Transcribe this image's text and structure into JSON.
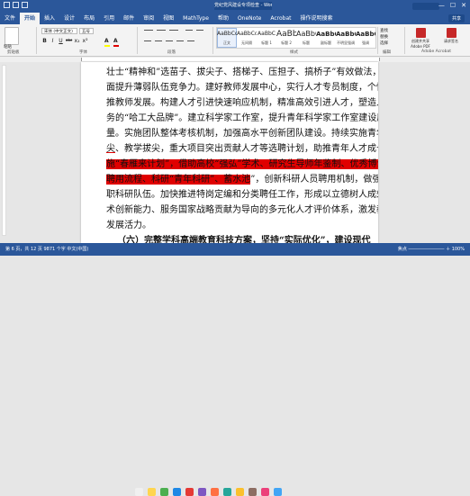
{
  "window": {
    "title": "党纪党风建设专项检查 - Word",
    "minimize": "—",
    "maximize": "☐",
    "close": "✕"
  },
  "tabs": [
    "文件",
    "开始",
    "插入",
    "设计",
    "布局",
    "引用",
    "邮件",
    "审阅",
    "视图",
    "MathType",
    "帮助",
    "OneNote",
    "Acrobat",
    "操作说明搜索"
  ],
  "share_label": "共享",
  "ribbon": {
    "paste_label": "粘贴",
    "font_name": "宋体 (中文正文)",
    "font_size": "五号",
    "format_buttons": [
      "B",
      "I",
      "U",
      "abc",
      "x₂",
      "x²"
    ],
    "highlight_glyph": "A",
    "font_color_glyph": "A",
    "styles": [
      {
        "sample": "AaBbCcDd",
        "name": "正文"
      },
      {
        "sample": "AaBbCcDd",
        "name": "无间隔"
      },
      {
        "sample": "AaBbC",
        "name": "标题 1"
      },
      {
        "sample": "AaBbC",
        "name": "标题 2"
      },
      {
        "sample": "AaBbC",
        "name": "标题"
      },
      {
        "sample": "AaBbC",
        "name": "副标题"
      },
      {
        "sample": "AaBbC",
        "name": "不明显强调"
      },
      {
        "sample": "AaBbCc",
        "name": "强调"
      }
    ],
    "edit_items": [
      "查找",
      "替换",
      "选择"
    ],
    "acrobat_buttons": [
      "创建并共享 Adobe PDF",
      "请求签名"
    ],
    "group_labels": [
      "剪贴板",
      "字体",
      "段落",
      "样式",
      "编辑",
      "Adobe Acrobat"
    ]
  },
  "document": {
    "line1": "壮士“精神和”选苗子、拔尖子、搭梯子、压担子、搞桥子”有效做法，全",
    "line2": "面提升薄弱队伍竞争力。建好教师发展中心，实行人才专员制度，个性化助",
    "line3": "推教师发展。构建人才引进快速响应机制，精准高效引进人才，塑造人才服",
    "line4": "务的“哈工大品牌”。建立科学家工作室，提升青年科学家工作室建设质",
    "line5": "量。实施团队整体考核机制，加强高水平创新团队建设。持续实施青年拔",
    "line6a": "尖",
    "line6b": "、教学拔尖，重大项目突出贡献人才等选聘计划，助推青年人才成长。",
    "line6c": "实",
    "line7": "施“春雁来计划”，借助高校“强弘”学术、研究生导师年鉴制、优秀博士后",
    "line8a": "聘用流程、科",
    "line8b": "研“青年科研”、蓄水池",
    "line8c": "”，创新科研人员聘用机制，做强专",
    "line9": "职科研队伍。加快推进特岗定编和分类聘任工作，形成以立德树人成效、学",
    "line10": "术创新能力、服务国家战略贡献为导向的多元化人才评价体系，激发教职工",
    "line11": "发展活力。",
    "heading": "（六）完整学科高端教育科技方案，坚持“实际优化”，建设现代"
  },
  "status": {
    "left": "第 6 页，共 12 页   9871 个字   中文(中国)",
    "right": "焦点   ―――――――― ＋ 100%"
  },
  "colors": {
    "brand": "#2b579a",
    "highlight_red": "#e00000",
    "page": "#ffffff"
  }
}
